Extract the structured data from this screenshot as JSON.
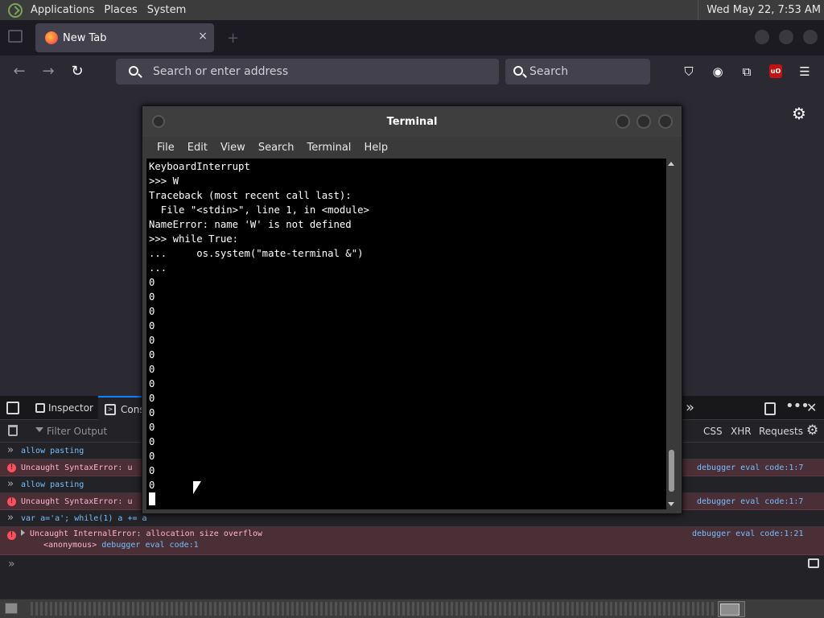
{
  "system_panel": {
    "menus": [
      "Applications",
      "Places",
      "System"
    ],
    "clock": "Wed May 22,  7:53 AM"
  },
  "browser": {
    "tab_title": "New Tab",
    "tab_close": "×",
    "address_placeholder": "Search or enter address",
    "search_placeholder": "Search",
    "ublock_badge": "uO",
    "icons": [
      "back-icon",
      "forward-icon",
      "reload-icon",
      "pocket-icon",
      "account-icon",
      "extensions-icon",
      "ublock-icon",
      "hamburger-menu-icon",
      "settings-gear-icon"
    ]
  },
  "devtools": {
    "tabs": {
      "inspector": "Inspector",
      "console": "Cons"
    },
    "filter_placeholder": "Filter Output",
    "filter_buttons": {
      "css": "CSS",
      "xhr": "XHR",
      "requests": "Requests"
    },
    "messages": [
      {
        "type": "input",
        "text": "allow pasting"
      },
      {
        "type": "error",
        "text": "Uncaught SyntaxError: u",
        "location": "debugger eval code:1:7"
      },
      {
        "type": "input",
        "text": "allow pasting"
      },
      {
        "type": "error",
        "text": "Uncaught SyntaxError: u",
        "location": "debugger eval code:1:7"
      },
      {
        "type": "input",
        "text": "var a='a'; while(1) a += a"
      },
      {
        "type": "error",
        "text": "Uncaught InternalError: allocation size overflow",
        "location": "debugger eval code:1:21",
        "stack_fn": "<anonymous>",
        "stack_loc": "debugger eval code:1"
      }
    ]
  },
  "terminal": {
    "title": "Terminal",
    "menus": [
      "File",
      "Edit",
      "View",
      "Search",
      "Terminal",
      "Help"
    ],
    "lines": [
      "KeyboardInterrupt",
      ">>> W",
      "Traceback (most recent call last):",
      "  File \"<stdin>\", line 1, in <module>",
      "NameError: name 'W' is not defined",
      ">>> while True:",
      "...     os.system(\"mate-terminal &\")",
      "...",
      "0",
      "0",
      "0",
      "0",
      "0",
      "0",
      "0",
      "0",
      "0",
      "0",
      "0",
      "0",
      "0",
      "0",
      "0"
    ],
    "scroll": {
      "thumb_start": 0.83,
      "thumb_size": 0.12
    }
  }
}
